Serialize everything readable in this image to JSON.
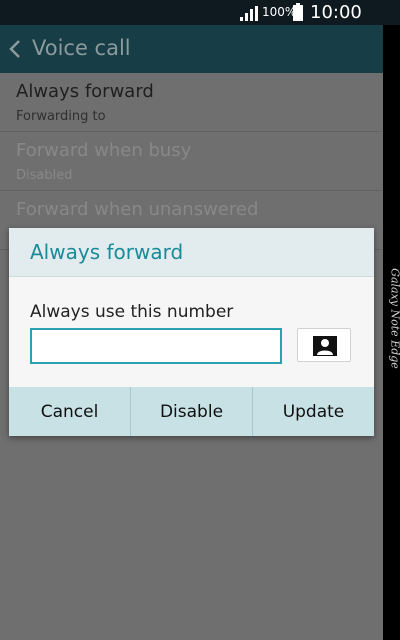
{
  "status_bar": {
    "battery_percent": "100%",
    "time": "10:00",
    "icons": [
      "signal-icon",
      "battery-icon"
    ]
  },
  "action_bar": {
    "title": "Voice call",
    "back_icon": "chevron-left-icon"
  },
  "settings": [
    {
      "title": "Always forward",
      "subtitle": "Forwarding to",
      "enabled": true
    },
    {
      "title": "Forward when busy",
      "subtitle": "Disabled",
      "enabled": false
    },
    {
      "title": "Forward when unanswered",
      "subtitle": "",
      "enabled": false
    }
  ],
  "device": {
    "edge_label": "Galaxy Note Edge"
  },
  "dialog": {
    "title": "Always forward",
    "label": "Always use this number",
    "input_value": "",
    "contact_icon": "contact-icon",
    "buttons": {
      "cancel": "Cancel",
      "disable": "Disable",
      "update": "Update"
    }
  },
  "colors": {
    "accent": "#1a8a98",
    "action_bar": "#173d46",
    "dialog_buttons": "#c8e1e5"
  }
}
